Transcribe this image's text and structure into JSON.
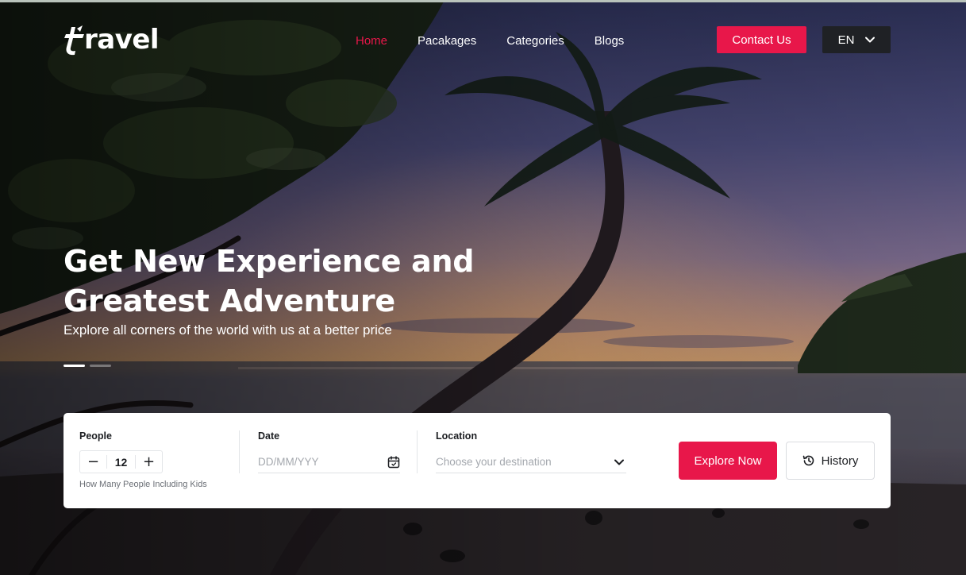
{
  "brand": {
    "logo_text": "ravel",
    "logo_full": "travel",
    "accent_color": "#e8174a"
  },
  "nav": {
    "items": [
      {
        "label": "Home",
        "active": true
      },
      {
        "label": "Pacakages",
        "active": false
      },
      {
        "label": "Categories",
        "active": false
      },
      {
        "label": "Blogs",
        "active": false
      }
    ],
    "contact_label": "Contact Us",
    "language": "EN"
  },
  "hero": {
    "title_line1": "Get New Experience and",
    "title_line2": "Greatest Adventure",
    "subtitle": "Explore all corners of the world with us at a better price",
    "slide_count": 2,
    "active_slide": 1
  },
  "search": {
    "people": {
      "label": "People",
      "value": "12",
      "minus": "−",
      "plus": "+",
      "hint": "How Many People Including Kids"
    },
    "date": {
      "label": "Date",
      "placeholder": "DD/MM/YYY",
      "icon": "calendar-icon"
    },
    "location": {
      "label": "Location",
      "placeholder": "Choose your destination",
      "icon": "chevron-down-icon"
    },
    "explore_label": "Explore Now",
    "history_label": "History",
    "history_icon": "history-icon"
  }
}
